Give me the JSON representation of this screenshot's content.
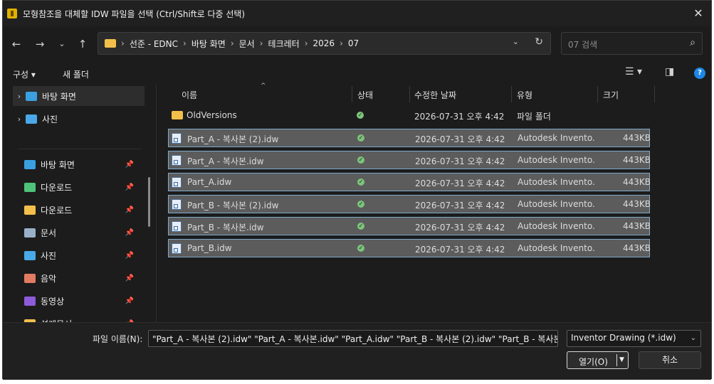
{
  "window": {
    "title": "모형참조을 대체할 IDW 파일을 선택 (Ctrl/Shift로 다중 선택)"
  },
  "breadcrumb": [
    "선준 - EDNC",
    "바탕 화면",
    "문서",
    "테크레터",
    "2026",
    "07"
  ],
  "search": {
    "placeholder": "07 검색"
  },
  "toolbar": {
    "organize": "구성 ▾",
    "new_folder": "새 폴더"
  },
  "sidebar": {
    "tree": [
      {
        "label": "바탕 화면",
        "icon": "desktop-icon",
        "color": "#3aa0e0"
      },
      {
        "label": "사진",
        "icon": "pictures-icon",
        "color": "#4aa8e8"
      }
    ],
    "quick": [
      {
        "label": "바탕 화면",
        "icon": "desktop-icon",
        "color": "#3aa0e0"
      },
      {
        "label": "다운로드",
        "icon": "download-icon",
        "color": "#4fc27a"
      },
      {
        "label": "다운로드",
        "icon": "folder-icon",
        "color": "#f2c04a"
      },
      {
        "label": "문서",
        "icon": "documents-icon",
        "color": "#9ab0c8"
      },
      {
        "label": "사진",
        "icon": "pictures-icon",
        "color": "#4aa8e8"
      },
      {
        "label": "음악",
        "icon": "music-icon",
        "color": "#e27b63"
      },
      {
        "label": "동영상",
        "icon": "videos-icon",
        "color": "#8c5bd8"
      },
      {
        "label": "설계문서",
        "icon": "folder-icon",
        "color": "#f2c04a"
      }
    ]
  },
  "columns": {
    "name": "이름",
    "status": "상태",
    "modified": "수정한 날짜",
    "type": "유형",
    "size": "크기"
  },
  "files": [
    {
      "name": "OldVersions",
      "kind": "folder",
      "modified": "2026-07-31 오후 4:42",
      "type": "파일 폴더",
      "size": "",
      "selected": false
    },
    {
      "name": "Part_A - 복사본 (2).idw",
      "kind": "idw",
      "modified": "2026-07-31 오후 4:42",
      "type": "Autodesk Invento...",
      "size": "443KB",
      "selected": true
    },
    {
      "name": "Part_A - 복사본.idw",
      "kind": "idw",
      "modified": "2026-07-31 오후 4:42",
      "type": "Autodesk Invento...",
      "size": "443KB",
      "selected": true
    },
    {
      "name": "Part_A.idw",
      "kind": "idw",
      "modified": "2026-07-31 오후 4:42",
      "type": "Autodesk Invento...",
      "size": "443KB",
      "selected": true
    },
    {
      "name": "Part_B - 복사본 (2).idw",
      "kind": "idw",
      "modified": "2026-07-31 오후 4:42",
      "type": "Autodesk Invento...",
      "size": "443KB",
      "selected": true
    },
    {
      "name": "Part_B - 복사본.idw",
      "kind": "idw",
      "modified": "2026-07-31 오후 4:42",
      "type": "Autodesk Invento...",
      "size": "443KB",
      "selected": true
    },
    {
      "name": "Part_B.idw",
      "kind": "idw",
      "modified": "2026-07-31 오후 4:42",
      "type": "Autodesk Invento...",
      "size": "443KB",
      "selected": true
    }
  ],
  "bottom": {
    "filename_label": "파일 이름(N):",
    "filename_value": "\"Part_A - 복사본 (2).idw\" \"Part_A - 복사본.idw\" \"Part_A.idw\" \"Part_B - 복사본 (2).idw\" \"Part_B - 복사본",
    "filter_value": "Inventor Drawing (*.idw)",
    "open_label": "열기(O)",
    "cancel_label": "취소"
  }
}
